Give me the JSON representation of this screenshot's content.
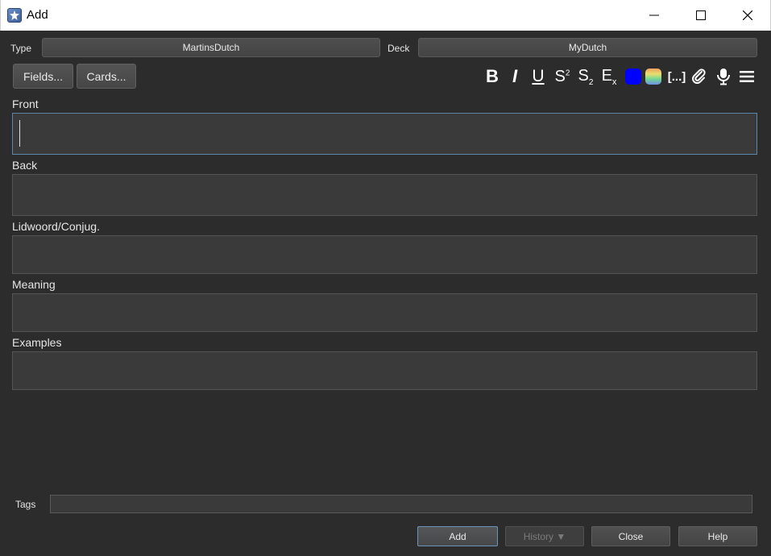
{
  "window": {
    "title": "Add",
    "minimize_icon": "minimize-icon",
    "maximize_icon": "maximize-icon",
    "close_icon": "close-icon"
  },
  "note_type": {
    "label": "Type",
    "value": "MartinsDutch"
  },
  "deck": {
    "label": "Deck",
    "value": "MyDutch"
  },
  "buttons": {
    "fields": "Fields...",
    "cards": "Cards..."
  },
  "toolbar": {
    "bold": "B",
    "italic": "I",
    "underline": "U",
    "superscript": "S",
    "superscript_mark": "2",
    "subscript": "S",
    "subscript_mark": "2",
    "clear_format": "E",
    "clear_format_mark": "x",
    "cloze": "[...]",
    "text_color": "#0000ff"
  },
  "fields": [
    {
      "label": "Front",
      "value": ""
    },
    {
      "label": "Back",
      "value": ""
    },
    {
      "label": "Lidwoord/Conjug.",
      "value": ""
    },
    {
      "label": "Meaning",
      "value": ""
    },
    {
      "label": "Examples",
      "value": ""
    }
  ],
  "tags": {
    "label": "Tags",
    "value": ""
  },
  "actions": {
    "add": "Add",
    "history": "History ▼",
    "close": "Close",
    "help": "Help"
  },
  "colors": {
    "background": "#2c2c2d",
    "focus_border": "#5c87ad"
  }
}
